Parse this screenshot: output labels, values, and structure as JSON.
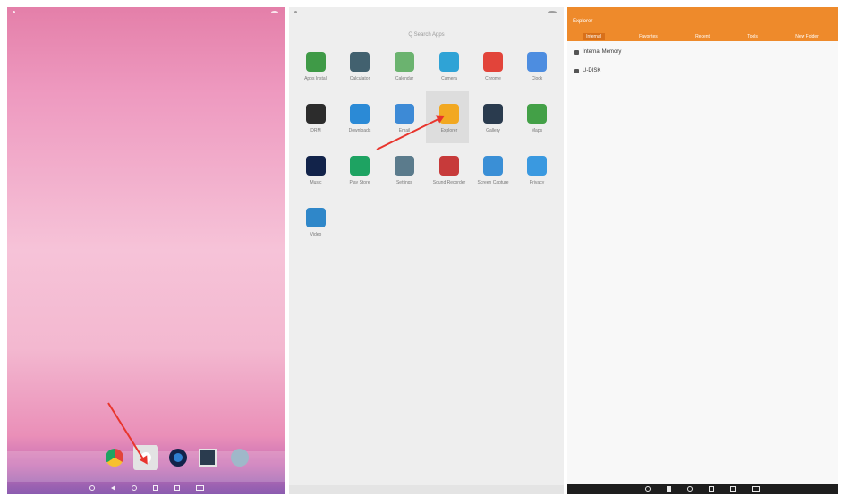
{
  "drawer": {
    "search_placeholder": "Q  Search Apps",
    "apps": [
      {
        "label": "Apps Install",
        "icon": "apps-install-icon",
        "color": "#3f9a47"
      },
      {
        "label": "Calculator",
        "icon": "calculator-icon",
        "color": "#42616f"
      },
      {
        "label": "Calendar",
        "icon": "calendar-icon",
        "color": "#6bb36f"
      },
      {
        "label": "Camera",
        "icon": "camera-icon",
        "color": "#2fa3d6"
      },
      {
        "label": "Chrome",
        "icon": "chrome-icon",
        "color": "#e2443a"
      },
      {
        "label": "Clock",
        "icon": "clock-icon",
        "color": "#4d8de0"
      },
      {
        "label": "DRM",
        "icon": "drm-icon",
        "color": "#2c2c2c"
      },
      {
        "label": "Downloads",
        "icon": "downloads-icon",
        "color": "#2b8ad6"
      },
      {
        "label": "Email",
        "icon": "email-icon",
        "color": "#3d8ad6"
      },
      {
        "label": "Explorer",
        "icon": "explorer-icon",
        "color": "#f2a821"
      },
      {
        "label": "Gallery",
        "icon": "gallery-icon",
        "color": "#2a3b4e"
      },
      {
        "label": "Maps",
        "icon": "maps-icon",
        "color": "#43a047"
      },
      {
        "label": "Music",
        "icon": "music-icon",
        "color": "#12234a"
      },
      {
        "label": "Play Store",
        "icon": "play-store-icon",
        "color": "#1ea362"
      },
      {
        "label": "Settings",
        "icon": "settings-icon",
        "color": "#5b7b8c"
      },
      {
        "label": "Sound Recorder",
        "icon": "sound-recorder-icon",
        "color": "#c73a3a"
      },
      {
        "label": "Screen Capture",
        "icon": "screen-capture-icon",
        "color": "#3a8fd6"
      },
      {
        "label": "Privacy",
        "icon": "privacy-icon",
        "color": "#3a99e0"
      },
      {
        "label": "Video",
        "icon": "video-icon",
        "color": "#2f87c9"
      }
    ]
  },
  "explorer": {
    "title": "Explorer",
    "tabs": [
      "Internal",
      "Favorites",
      "Recent",
      "Tools",
      "New Folder"
    ],
    "rows": [
      "Internal Memory",
      "U-DISK"
    ]
  },
  "dock": {
    "icons": [
      "chrome-icon",
      "explorer-icon",
      "music-icon",
      "gallery-icon",
      "settings-icon"
    ]
  },
  "colors": {
    "accent": "#ee8a2b",
    "arrow": "#e8352d"
  }
}
